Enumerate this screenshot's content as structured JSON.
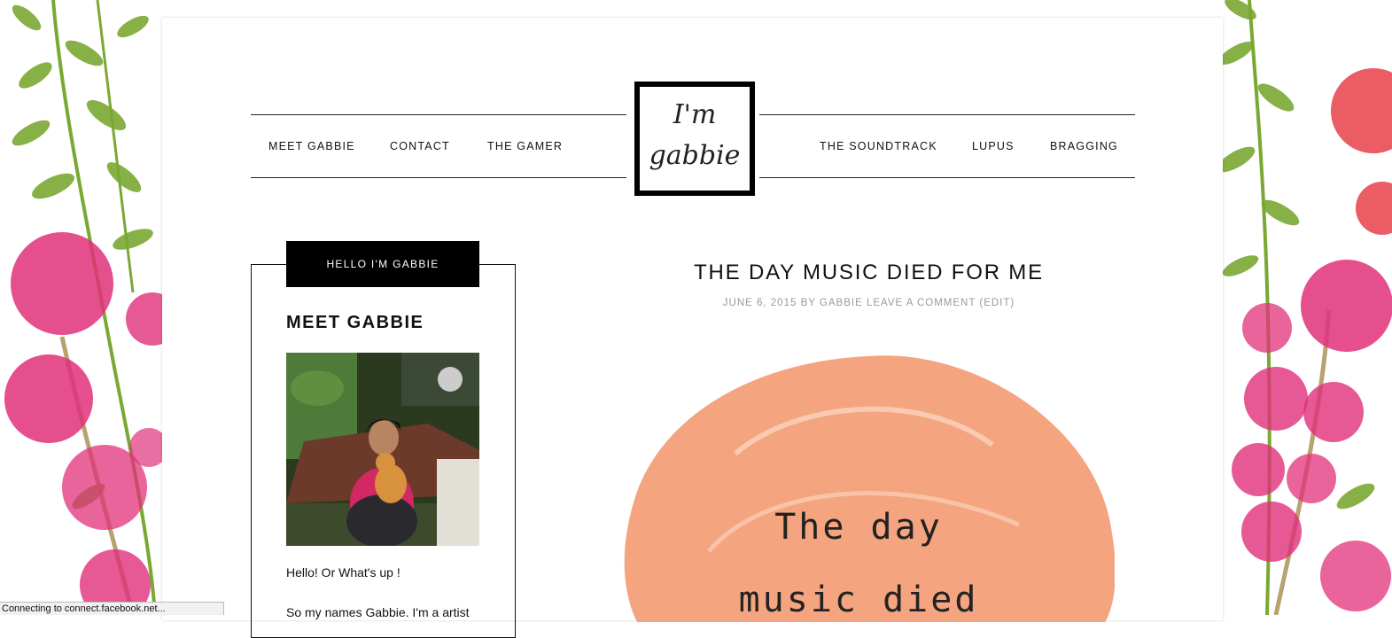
{
  "nav": {
    "left": [
      "MEET GABBIE",
      "CONTACT",
      "THE GAMER"
    ],
    "right": [
      "THE SOUNDTRACK",
      "LUPUS",
      "BRAGGING"
    ]
  },
  "logo": {
    "line1": "I'm",
    "line2": "gabbie"
  },
  "sidebar": {
    "tab_label": "HELLO I'M GABBIE",
    "title": "MEET GABBIE",
    "intro_line1": "Hello! Or  What's up !",
    "intro_line2": "So my names Gabbie.  I'm a artist"
  },
  "post": {
    "title": "THE DAY MUSIC DIED FOR ME",
    "date": "JUNE 6, 2015",
    "by": "BY",
    "author": "GABBIE",
    "comment_link": "LEAVE A COMMENT",
    "edit_link": "(EDIT)",
    "image_text_line1": "The day",
    "image_text_line2": "music died"
  },
  "status_bar": {
    "text": "Connecting to connect.facebook.net..."
  },
  "colors": {
    "feature_blob": "#f4a47f",
    "flower_pink": "#e0307a",
    "flower_red": "#e8404a",
    "leaf_green": "#7aa832"
  }
}
